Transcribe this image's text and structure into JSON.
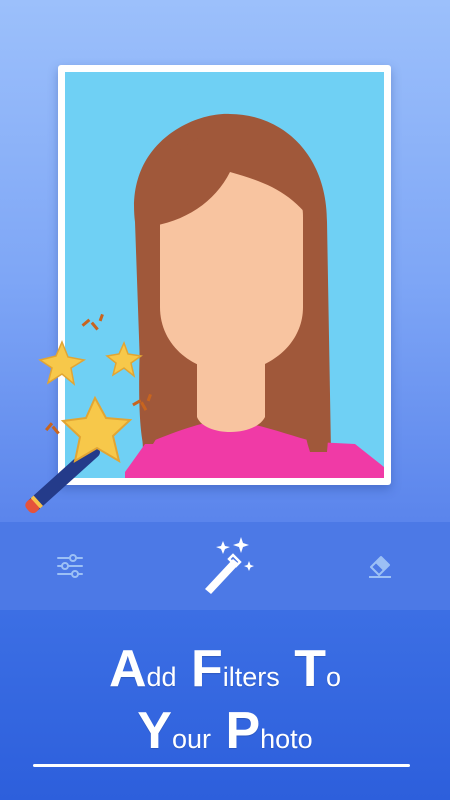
{
  "toolbar": {
    "tools": [
      {
        "icon": "sliders-icon",
        "active": false
      },
      {
        "icon": "magic-wand-icon",
        "active": true
      },
      {
        "icon": "eraser-icon",
        "active": false
      }
    ]
  },
  "headline": {
    "line1": [
      {
        "cap": "A",
        "rest": "dd"
      },
      {
        "cap": "F",
        "rest": "ilters"
      },
      {
        "cap": "T",
        "rest": "o"
      }
    ],
    "line2": [
      {
        "cap": "Y",
        "rest": "our"
      },
      {
        "cap": "P",
        "rest": "hoto"
      }
    ]
  },
  "colors": {
    "toolbar": "#4c79e6",
    "photo_background": "#6fd0f4",
    "hair": "#a0583a",
    "skin": "#f8c4a0",
    "shirt": "#f03aa6",
    "star": "#f7c84a"
  }
}
